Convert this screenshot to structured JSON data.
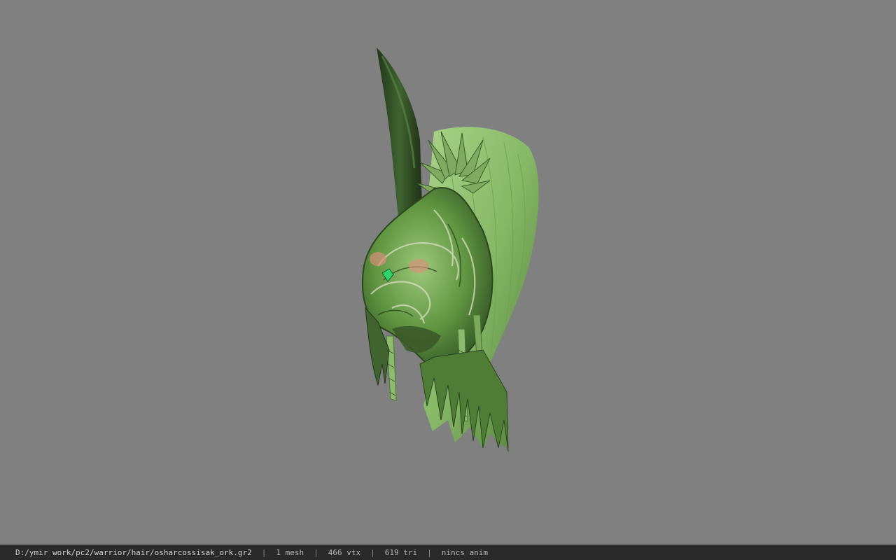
{
  "viewer": {
    "background_color": "#808080"
  },
  "model": {
    "icon": "green-helmet-hair-model",
    "colors": {
      "dark_green": "#2e4a22",
      "mid_green": "#5a8a3c",
      "light_green": "#9cc77a",
      "accent_pink": "#d98f7a",
      "gem_green": "#2fd36a"
    }
  },
  "status_bar": {
    "file_path": "D:/ymir work/pc2/warrior/hair/osharcossisak_ork.gr2",
    "mesh_count": "1 mesh",
    "vertex_count": "466 vtx",
    "triangle_count": "619 tri",
    "anim_status": "nincs anim",
    "separator": "|"
  }
}
